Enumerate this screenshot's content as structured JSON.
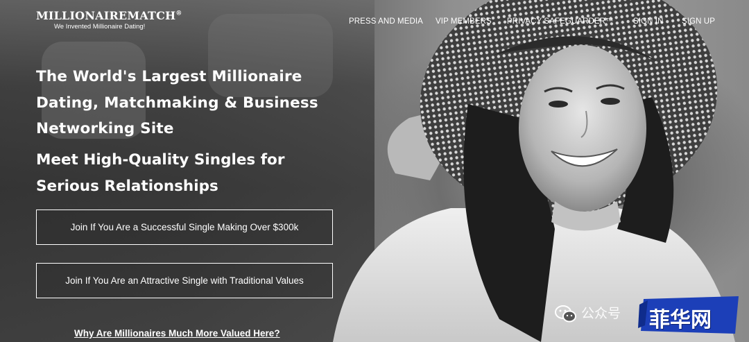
{
  "header": {
    "logo_name": "MILLIONAIREMATCH",
    "logo_mark": "®",
    "tagline": "We Invented Millionaire Dating!",
    "nav": [
      {
        "label": "PRESS AND MEDIA"
      },
      {
        "label": "VIP MEMBERS"
      },
      {
        "label": "PRIVACY SAFEGUARDER™"
      },
      {
        "label": "SIGN IN"
      },
      {
        "label": "SIGN UP"
      }
    ]
  },
  "hero": {
    "headline": "The World's Largest Millionaire Dating, Matchmaking & Business Networking Site",
    "subheadline": "Meet High-Quality Singles for Serious Relationships",
    "cta_primary": "Join If You Are a Successful Single Making Over $300k",
    "cta_secondary": "Join If You Are an Attractive Single with Traditional Values",
    "why_link": "Why Are Millionaires Much More Valued Here?"
  },
  "watermark": {
    "icon": "wechat-icon",
    "text": "公众号",
    "badge": "菲华网",
    "badge_color": "#1c3fb8"
  },
  "colors": {
    "text": "#ffffff",
    "background": "#3a3a3a"
  }
}
